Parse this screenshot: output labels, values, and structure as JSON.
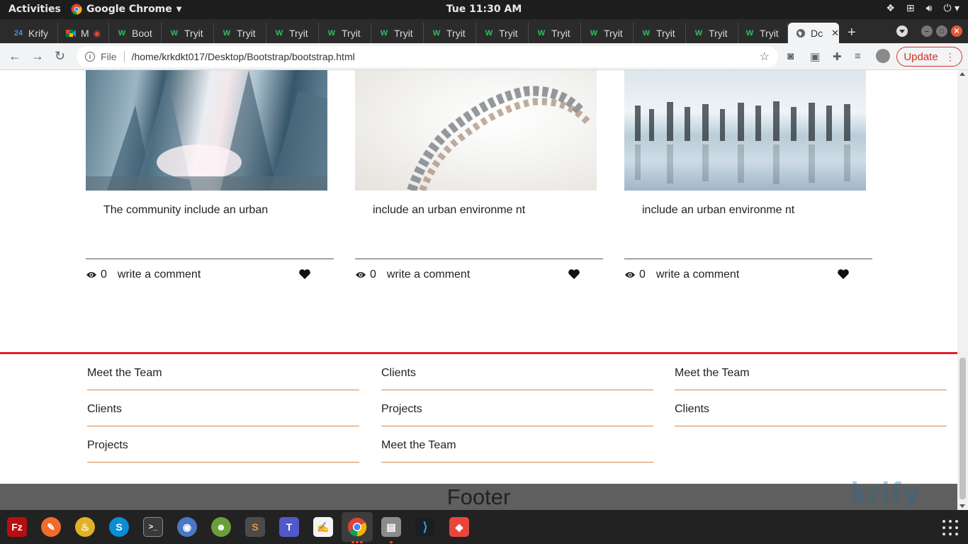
{
  "system_bar": {
    "activities": "Activities",
    "app_name": "Google Chrome",
    "clock": "Tue 11:30 AM"
  },
  "tabs": [
    {
      "label": "Krify",
      "favicon": "24-icon"
    },
    {
      "label": "M",
      "favicon": "meet-icon"
    },
    {
      "label": "Boot",
      "favicon": "w3-icon"
    },
    {
      "label": "Tryit",
      "favicon": "w3-icon"
    },
    {
      "label": "Tryit",
      "favicon": "w3-icon"
    },
    {
      "label": "Tryit",
      "favicon": "w3-icon"
    },
    {
      "label": "Tryit",
      "favicon": "w3-icon"
    },
    {
      "label": "Tryit",
      "favicon": "w3-icon"
    },
    {
      "label": "Tryit",
      "favicon": "w3-icon"
    },
    {
      "label": "Tryit",
      "favicon": "w3-icon"
    },
    {
      "label": "Tryit",
      "favicon": "w3-icon"
    },
    {
      "label": "Tryit",
      "favicon": "w3-icon"
    },
    {
      "label": "Tryit",
      "favicon": "w3-icon"
    },
    {
      "label": "Tryit",
      "favicon": "w3-icon"
    },
    {
      "label": "Tryit",
      "favicon": "w3-icon"
    },
    {
      "label": "Dc",
      "favicon": "globe-icon",
      "active": true
    }
  ],
  "address_bar": {
    "scheme": "File",
    "url": "/home/krkdkt017/Desktop/Bootstrap/bootstrap.html",
    "update_label": "Update"
  },
  "cards": [
    {
      "caption": "The community include an urban",
      "views": "0",
      "comment_label": "write a comment",
      "image": "building"
    },
    {
      "caption": "include an urban environme nt",
      "views": "0",
      "comment_label": "write a comment",
      "image": "dna"
    },
    {
      "caption": "include an urban environme nt",
      "views": "0",
      "comment_label": "write a comment",
      "image": "people"
    }
  ],
  "footer_columns": [
    [
      "Meet the Team",
      "Clients",
      "Projects"
    ],
    [
      "Clients",
      "Projects",
      "Meet the Team"
    ],
    [
      "Meet the Team",
      "Clients"
    ]
  ],
  "footer_bar": {
    "label": "Footer",
    "watermark": "krify"
  },
  "colors": {
    "accent_red": "#e0202c",
    "link_rule": "#d4874b",
    "footer_bg": "#5f5f5f",
    "update_red": "#d93025"
  }
}
